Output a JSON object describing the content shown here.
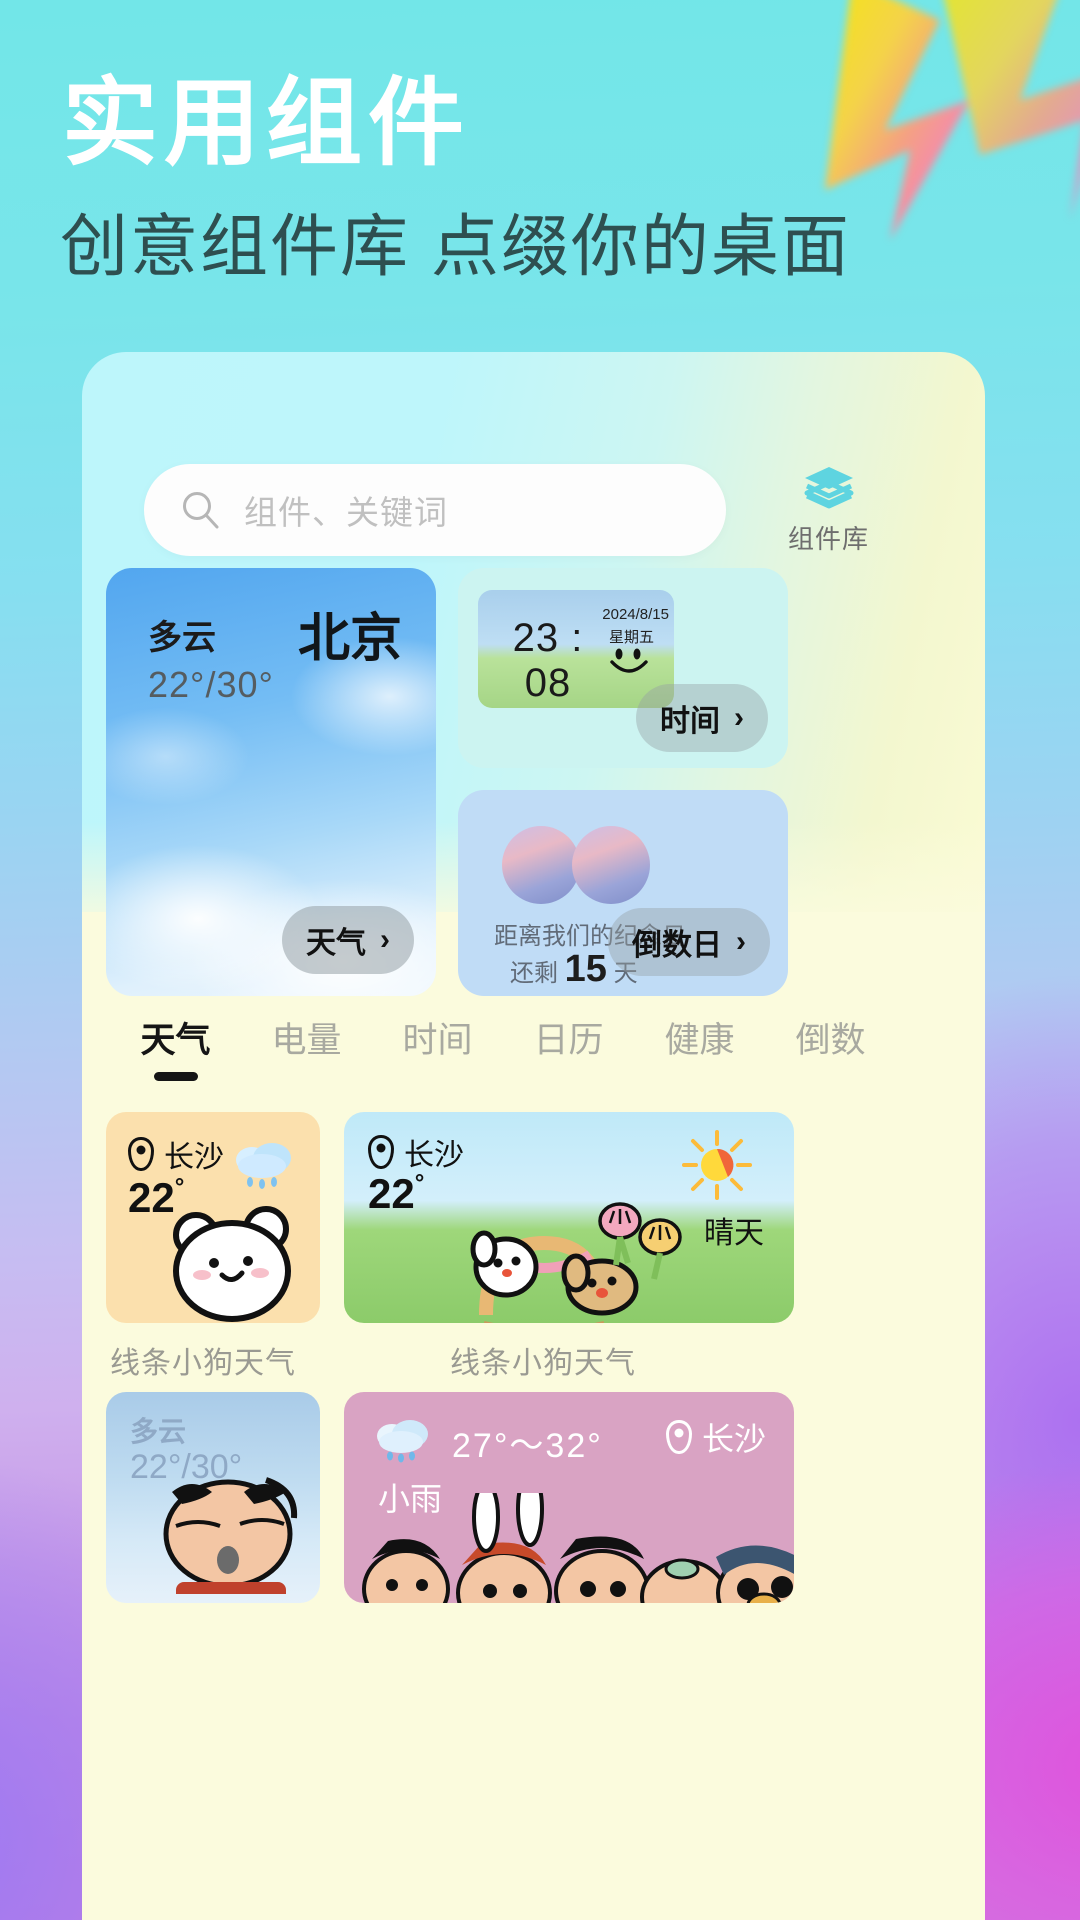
{
  "hero": {
    "title": "实用组件",
    "subtitle": "创意组件库 点缀你的桌面"
  },
  "search": {
    "placeholder": "组件、关键词",
    "icon": "search-icon"
  },
  "library_button": {
    "label": "组件库",
    "icon": "layers-icon",
    "color": "#58d3e0"
  },
  "featured": {
    "weather_card": {
      "condition": "多云",
      "temperature": "22°/30°",
      "city": "北京",
      "pill_label": "天气",
      "pill_chevron": "›"
    },
    "clock_card": {
      "time": "23 : 08",
      "date": "2024/8/15",
      "weekday": "星期五",
      "pill_label": "时间",
      "pill_chevron": "›"
    },
    "countdown_card": {
      "line1": "距离我们的纪念日",
      "line2_prefix": "还剩 ",
      "days": "15",
      "line2_suffix": " 天",
      "pill_label": "倒数日",
      "pill_chevron": "›"
    }
  },
  "tabs": [
    {
      "label": "天气",
      "active": true
    },
    {
      "label": "电量",
      "active": false
    },
    {
      "label": "时间",
      "active": false
    },
    {
      "label": "日历",
      "active": false
    },
    {
      "label": "健康",
      "active": false
    },
    {
      "label": "倒数",
      "active": false
    }
  ],
  "widgets": {
    "row1": {
      "small": {
        "city": "长沙",
        "temperature": "22",
        "degree": "°",
        "icon": "rain-cloud-icon",
        "label": "线条小狗天气"
      },
      "large": {
        "city": "长沙",
        "temperature": "22",
        "degree": "°",
        "icon": "sun-icon",
        "condition": "晴天",
        "label": "线条小狗天气"
      }
    },
    "row2": {
      "small": {
        "condition": "多云",
        "temperature": "22°/30°"
      },
      "large": {
        "icon": "rain-cloud-icon",
        "range": "27°～32°",
        "condition": "小雨",
        "city": "长沙"
      }
    }
  },
  "colors": {
    "accent": "#58d3e0",
    "panel_top": "#bdf6fb",
    "panel_bottom": "#fbfbdd",
    "heading": "#ffffff",
    "subheading": "#2e4f50"
  }
}
